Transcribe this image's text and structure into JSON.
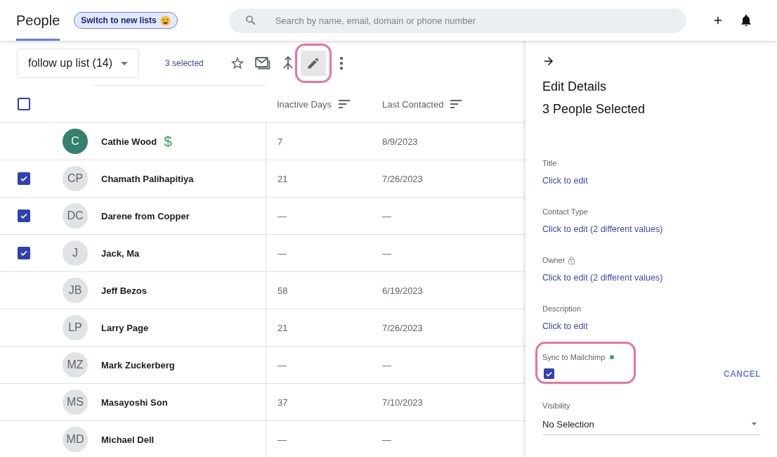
{
  "header": {
    "title": "People",
    "title_selected": true,
    "switch_button": "Switch to new lists",
    "search": {
      "placeholder": "Search by name, email, domain or phone number"
    }
  },
  "toolbar": {
    "list_dropdown": "follow up list (14)",
    "selected_count": "3 selected",
    "actions": [
      {
        "kind": "star",
        "highlighted": false,
        "active": false
      },
      {
        "kind": "mail",
        "highlighted": false,
        "active": false
      },
      {
        "kind": "merge",
        "highlighted": false,
        "active": false
      },
      {
        "kind": "edit",
        "highlighted": true,
        "active": true
      },
      {
        "kind": "more",
        "highlighted": false,
        "active": false
      }
    ]
  },
  "table": {
    "select_all_checked": false,
    "columns": [
      {
        "label": "Inactive Days"
      },
      {
        "label": "Last Contacted"
      }
    ],
    "rows": [
      {
        "selected": false,
        "initials": "C",
        "color": "#35806f",
        "name": "Cathie Wood",
        "badge": "$",
        "inactive_days": "7",
        "last_contacted": "8/9/2023"
      },
      {
        "selected": true,
        "initials": "CP",
        "color": "#dfe3e6",
        "name": "Chamath Palihapitiya",
        "inactive_days": "21",
        "last_contacted": "7/26/2023"
      },
      {
        "selected": true,
        "initials": "DC",
        "color": "#dfe3e6",
        "name": "Darene from Copper",
        "inactive_days": "—",
        "last_contacted": "—"
      },
      {
        "selected": true,
        "initials": "J",
        "color": "#dfe3e6",
        "name": "Jack, Ma",
        "inactive_days": "—",
        "last_contacted": "—"
      },
      {
        "selected": false,
        "initials": "JB",
        "color": "#dfe3e6",
        "name": "Jeff Bezos",
        "inactive_days": "58",
        "last_contacted": "6/19/2023"
      },
      {
        "selected": false,
        "initials": "LP",
        "color": "#dfe3e6",
        "name": "Larry Page",
        "inactive_days": "21",
        "last_contacted": "7/26/2023"
      },
      {
        "selected": false,
        "initials": "MZ",
        "color": "#dfe3e6",
        "name": "Mark Zuckerberg",
        "inactive_days": "—",
        "last_contacted": "—"
      },
      {
        "selected": false,
        "initials": "MS",
        "color": "#dfe3e6",
        "name": "Masayoshi Son",
        "inactive_days": "37",
        "last_contacted": "7/10/2023"
      },
      {
        "selected": false,
        "initials": "MD",
        "color": "#dfe3e6",
        "name": "Michael Dell",
        "inactive_days": "—",
        "last_contacted": "—"
      }
    ]
  },
  "panel": {
    "heading": "Edit Details",
    "subheading": "3 People Selected",
    "fields": [
      {
        "kind": "link",
        "label": "Title",
        "value": "Click to edit",
        "locked": false,
        "highlighted": false
      },
      {
        "kind": "link",
        "label": "Contact Type",
        "value": "Click to edit (2 different values)",
        "locked": false,
        "highlighted": false
      },
      {
        "kind": "link",
        "label": "Owner",
        "value": "Click to edit (2 different values)",
        "locked": true,
        "highlighted": false
      },
      {
        "kind": "link",
        "label": "Description",
        "value": "Click to edit",
        "locked": false,
        "highlighted": false
      },
      {
        "kind": "checkbox",
        "label": "Sync to Mailchimp",
        "checked": true,
        "synced": true,
        "highlighted": true,
        "action": "CANCEL"
      },
      {
        "kind": "select",
        "label": "Visibility",
        "value": "No Selection",
        "locked": false,
        "highlighted": false
      }
    ]
  }
}
